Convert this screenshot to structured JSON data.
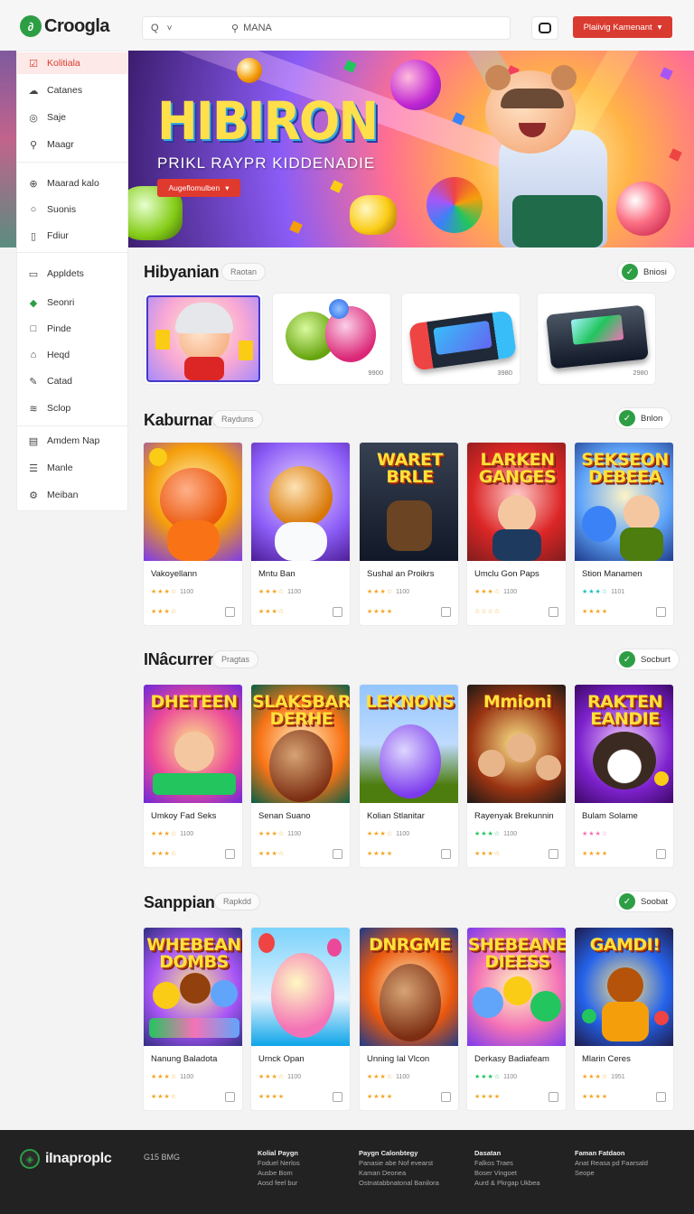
{
  "header": {
    "logo_text": "Croogla",
    "search_filter_label": "Q",
    "search_placeholder": "MANA",
    "cta_label": "Plaiivig Kamenant"
  },
  "sidebar": {
    "group1": [
      {
        "label": "Kolitiala",
        "icon": "checkbox-icon",
        "active": true
      },
      {
        "label": "Catanes",
        "icon": "cloud-icon"
      },
      {
        "label": "Saje",
        "icon": "globe-icon"
      },
      {
        "label": "Maagr",
        "icon": "search-icon"
      }
    ],
    "group2": [
      {
        "label": "Maarad kalo",
        "icon": "plus-circle-icon"
      },
      {
        "label": "Suonis",
        "icon": "circle-icon"
      },
      {
        "label": "Fdiur",
        "icon": "document-icon"
      }
    ],
    "group3": [
      {
        "label": "Appldets",
        "icon": "file-icon"
      },
      {
        "label": "Seonri",
        "icon": "diamond-icon"
      },
      {
        "label": "Pinde",
        "icon": "square-icon"
      },
      {
        "label": "Heqd",
        "icon": "tag-icon"
      },
      {
        "label": "Catad",
        "icon": "pencil-icon"
      },
      {
        "label": "Sclop",
        "icon": "layers-icon"
      }
    ],
    "group4": [
      {
        "label": "Amdem Nap",
        "icon": "map-icon"
      },
      {
        "label": "Manle",
        "icon": "list-icon"
      },
      {
        "label": "Meiban",
        "icon": "settings-icon"
      }
    ]
  },
  "hero": {
    "title": "HIBIRON",
    "subtitle": "PRIKL RAYPR KIDDENADIE",
    "button_label": "Augeflomulben"
  },
  "sections": [
    {
      "title": "Hibyanian",
      "badge": "Raotan",
      "more": "Bniosi"
    },
    {
      "title": "Kaburnan",
      "badge": "Rayduns",
      "more": "Bnlon"
    },
    {
      "title": "INâcurren",
      "badge": "Pragtas",
      "more": "Socburt"
    },
    {
      "title": "Sanppian",
      "badge": "Rapkdd",
      "more": "Soobat"
    }
  ],
  "devices": [
    {
      "name": "plush-toy",
      "price": ""
    },
    {
      "name": "squish-toys",
      "price": "9900"
    },
    {
      "name": "handheld-console",
      "price": "3980"
    },
    {
      "name": "retro-console",
      "price": "2980"
    }
  ],
  "games": {
    "row1": [
      {
        "name": "Vakoyellann",
        "count": "1100",
        "art_title": ""
      },
      {
        "name": "Mntu Ban",
        "count": "1100",
        "art_title": ""
      },
      {
        "name": "Sushal an Proikrs",
        "count": "1100",
        "art_title": "WARET BRLE"
      },
      {
        "name": "Umclu Gon Paps",
        "count": "1100",
        "art_title": "LARKEN GANGES"
      },
      {
        "name": "Stion Manamen",
        "count": "1101",
        "art_title": "SEKSEON DEBEEA"
      }
    ],
    "row2": [
      {
        "name": "Umkoy Fad Seks",
        "count": "1100",
        "art_title": "DHETEEN"
      },
      {
        "name": "Senan Suano",
        "count": "1100",
        "art_title": "SLAKSBAR DERHE"
      },
      {
        "name": "Kolian Stlanitar",
        "count": "1100",
        "art_title": "LEKNONS"
      },
      {
        "name": "Rayenyak Brekunnin",
        "count": "1100",
        "art_title": "Mmioni"
      },
      {
        "name": "Bulam Solame",
        "count": "",
        "art_title": "RAKTEN EANDIE"
      }
    ],
    "row3": [
      {
        "name": "Nanung Baladota",
        "count": "1100",
        "art_title": "WHEBEAN DOMBS"
      },
      {
        "name": "Urnck Opan",
        "count": "1100",
        "art_title": ""
      },
      {
        "name": "Unning Ial Vlcon",
        "count": "1100",
        "art_title": "DNRGME"
      },
      {
        "name": "Derkasy Badiafeam",
        "count": "1100",
        "art_title": "SHEBEANE DIEESS"
      },
      {
        "name": "Mlarin Ceres",
        "count": "1951",
        "art_title": "GAMDI!"
      }
    ]
  },
  "footer": {
    "logo_text": "iInaproplc",
    "tag": "G15 BMG",
    "columns": [
      {
        "heading": "Kolial Paygn",
        "lines": [
          "Foduel Nerlos",
          "Ausbe Bom",
          "Aosd feel bur"
        ]
      },
      {
        "heading": "Paygn Calonbtegy",
        "lines": [
          "Panasie abe Nof evearst",
          "Kaman Deonea",
          "Ostnatabbnatonal Banilora"
        ]
      },
      {
        "heading": "Dasatan",
        "lines": [
          "Falkos Traes",
          "Boser Vingoet",
          "Aurd & Pkrgap Ukbea"
        ]
      },
      {
        "heading": "Faman Fatdaon",
        "lines": [
          "Anat Reasa pd Faarsald",
          "Seope"
        ]
      }
    ]
  },
  "colors": {
    "accent": "#d93b30",
    "green": "#2e9e45"
  }
}
